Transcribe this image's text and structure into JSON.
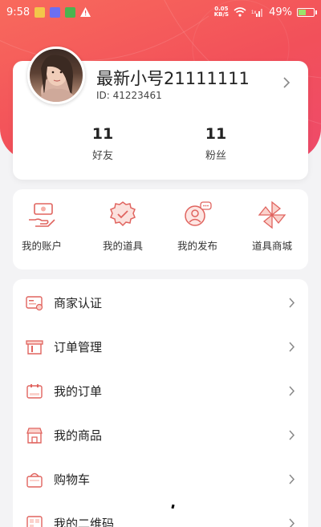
{
  "status_bar": {
    "time": "9:58",
    "net_speed": "0.05",
    "net_unit": "KB/S",
    "battery": "49%",
    "battery_level": 0.49
  },
  "profile": {
    "username": "最新小号21111111",
    "user_id": "ID: 41223461",
    "stats": [
      {
        "value": "11",
        "label": "好友"
      },
      {
        "value": "11",
        "label": "粉丝"
      }
    ]
  },
  "shortcuts": [
    {
      "label": "我的账户",
      "icon": "hand-money-icon"
    },
    {
      "label": "我的道具",
      "icon": "badge-icon"
    },
    {
      "label": "我的发布",
      "icon": "user-chat-icon"
    },
    {
      "label": "道具商城",
      "icon": "pinwheel-icon"
    }
  ],
  "menu": [
    {
      "label": "商家认证",
      "icon": "merchant-card-icon"
    },
    {
      "label": "订单管理",
      "icon": "order-manage-icon"
    },
    {
      "label": "我的订单",
      "icon": "order-icon"
    },
    {
      "label": "我的商品",
      "icon": "shop-icon"
    },
    {
      "label": "购物车",
      "icon": "cart-icon"
    },
    {
      "label": "我的二维码",
      "icon": "qrcode-icon"
    }
  ],
  "colors": {
    "header_gradient_start": "#f86a5c",
    "header_gradient_end": "#ee4a6a",
    "icon_accent": "#e0645f"
  }
}
